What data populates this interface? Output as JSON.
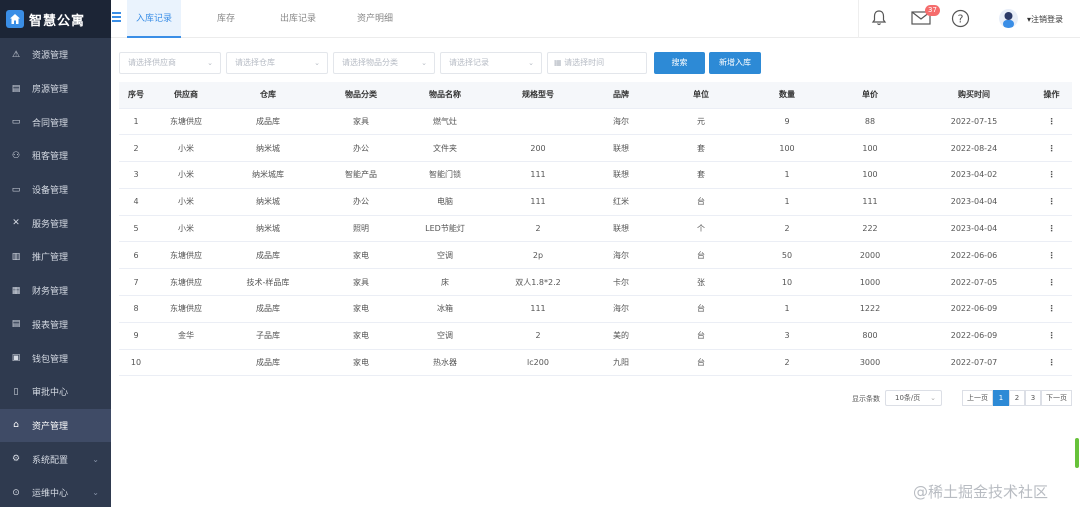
{
  "app": {
    "title": "智慧公寓"
  },
  "sidebar": {
    "items": [
      {
        "label": "资源管理",
        "icon": "warning-triangle-icon",
        "active": false
      },
      {
        "label": "房源管理",
        "icon": "building-icon",
        "active": false
      },
      {
        "label": "合同管理",
        "icon": "contract-icon",
        "active": false
      },
      {
        "label": "租客管理",
        "icon": "users-icon",
        "active": false
      },
      {
        "label": "设备管理",
        "icon": "monitor-icon",
        "active": false
      },
      {
        "label": "服务管理",
        "icon": "tools-icon",
        "active": false
      },
      {
        "label": "推广管理",
        "icon": "chart-icon",
        "active": false
      },
      {
        "label": "财务管理",
        "icon": "finance-icon",
        "active": false
      },
      {
        "label": "报表管理",
        "icon": "report-icon",
        "active": false
      },
      {
        "label": "钱包管理",
        "icon": "wallet-icon",
        "active": false
      },
      {
        "label": "审批中心",
        "icon": "approval-icon",
        "active": false
      },
      {
        "label": "资产管理",
        "icon": "home-icon",
        "active": true
      },
      {
        "label": "系统配置",
        "icon": "gear-icon",
        "active": false
      },
      {
        "label": "运维中心",
        "icon": "ops-icon",
        "active": false
      }
    ]
  },
  "header": {
    "tabs": [
      "入库记录",
      "库存",
      "出库记录",
      "资产明细"
    ],
    "active_tab": 0,
    "mail_badge": "37",
    "user_label": "▾注销登录"
  },
  "filters": {
    "supplier": "请选择供应商",
    "warehouse": "请选择仓库",
    "category": "请选择物品分类",
    "record": "请选择记录",
    "time": "请选择时间",
    "search_btn": "搜索",
    "add_btn": "新增入库"
  },
  "table": {
    "columns": [
      "序号",
      "供应商",
      "仓库",
      "物品分类",
      "物品名称",
      "规格型号",
      "品牌",
      "单位",
      "数量",
      "单价",
      "购买时间",
      "操作"
    ],
    "rows": [
      [
        "1",
        "东塘供应",
        "成品库",
        "家具",
        "燃气灶",
        "",
        "海尔",
        "元",
        "9",
        "88",
        "2022-07-15",
        "⋮"
      ],
      [
        "2",
        "小米",
        "纳米城",
        "办公",
        "文件夹",
        "200",
        "联想",
        "套",
        "100",
        "100",
        "2022-08-24",
        "⋮"
      ],
      [
        "3",
        "小米",
        "纳米城库",
        "智能产品",
        "智能门锁",
        "111",
        "联想",
        "套",
        "1",
        "100",
        "2023-04-02",
        "⋮"
      ],
      [
        "4",
        "小米",
        "纳米城",
        "办公",
        "电脑",
        "111",
        "红米",
        "台",
        "1",
        "111",
        "2023-04-04",
        "⋮"
      ],
      [
        "5",
        "小米",
        "纳米城",
        "照明",
        "LED节能灯",
        "2",
        "联想",
        "个",
        "2",
        "222",
        "2023-04-04",
        "⋮"
      ],
      [
        "6",
        "东塘供应",
        "成品库",
        "家电",
        "空调",
        "2p",
        "海尔",
        "台",
        "50",
        "2000",
        "2022-06-06",
        "⋮"
      ],
      [
        "7",
        "东塘供应",
        "技术-样品库",
        "家具",
        "床",
        "双人1.8*2.2",
        "卡尔",
        "张",
        "10",
        "1000",
        "2022-07-05",
        "⋮"
      ],
      [
        "8",
        "东塘供应",
        "成品库",
        "家电",
        "冰箱",
        "111",
        "海尔",
        "台",
        "1",
        "1222",
        "2022-06-09",
        "⋮"
      ],
      [
        "9",
        "金华",
        "子品库",
        "家电",
        "空调",
        "2",
        "美的",
        "台",
        "3",
        "800",
        "2022-06-09",
        "⋮"
      ],
      [
        "10",
        "",
        "成品库",
        "家电",
        "热水器",
        "lc200",
        "九阳",
        "台",
        "2",
        "3000",
        "2022-07-07",
        "⋮"
      ]
    ]
  },
  "pagination": {
    "label": "显示条数",
    "page_size": "10条/页",
    "prev": "上一页",
    "pages": [
      "1",
      "2",
      "3"
    ],
    "current": "1",
    "next": "下一页"
  },
  "watermark": "@稀土掘金技术社区",
  "colors": {
    "accent": "#2d8ad6",
    "sidebar_bg": "#2f3a4f",
    "badge": "#f56c6c"
  }
}
